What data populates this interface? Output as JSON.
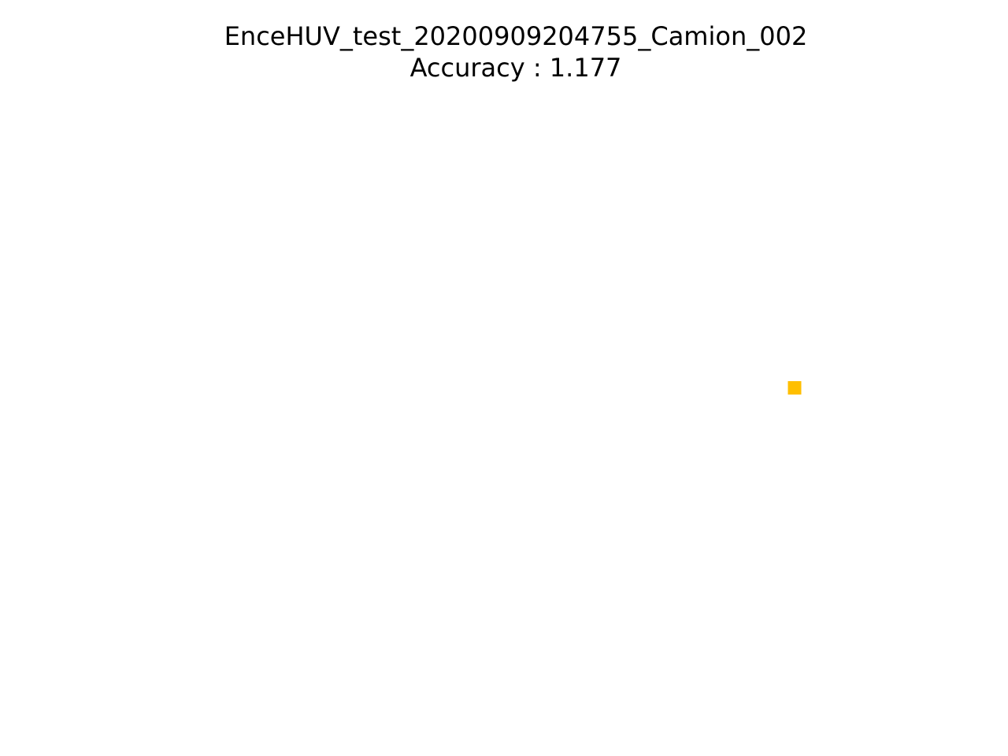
{
  "figure": {
    "title_line1": "EnceHUV_test_20200909204755_Camion_002",
    "title_line2": "Accuracy : 1.177"
  },
  "chart_data": {
    "type": "scatter",
    "title": "EnceHUV_test_20200909204755_Camion_002\nAccuracy : 1.177",
    "xlabel": "",
    "ylabel": "",
    "axes_visible": false,
    "grid": false,
    "series": [
      {
        "color": "#FFBF00",
        "marker": "square",
        "points": [
          {
            "x": 1.0,
            "y": 0.5
          }
        ]
      }
    ],
    "xlim": [
      0.0,
      1.0
    ],
    "ylim": [
      0.0,
      1.0
    ]
  }
}
